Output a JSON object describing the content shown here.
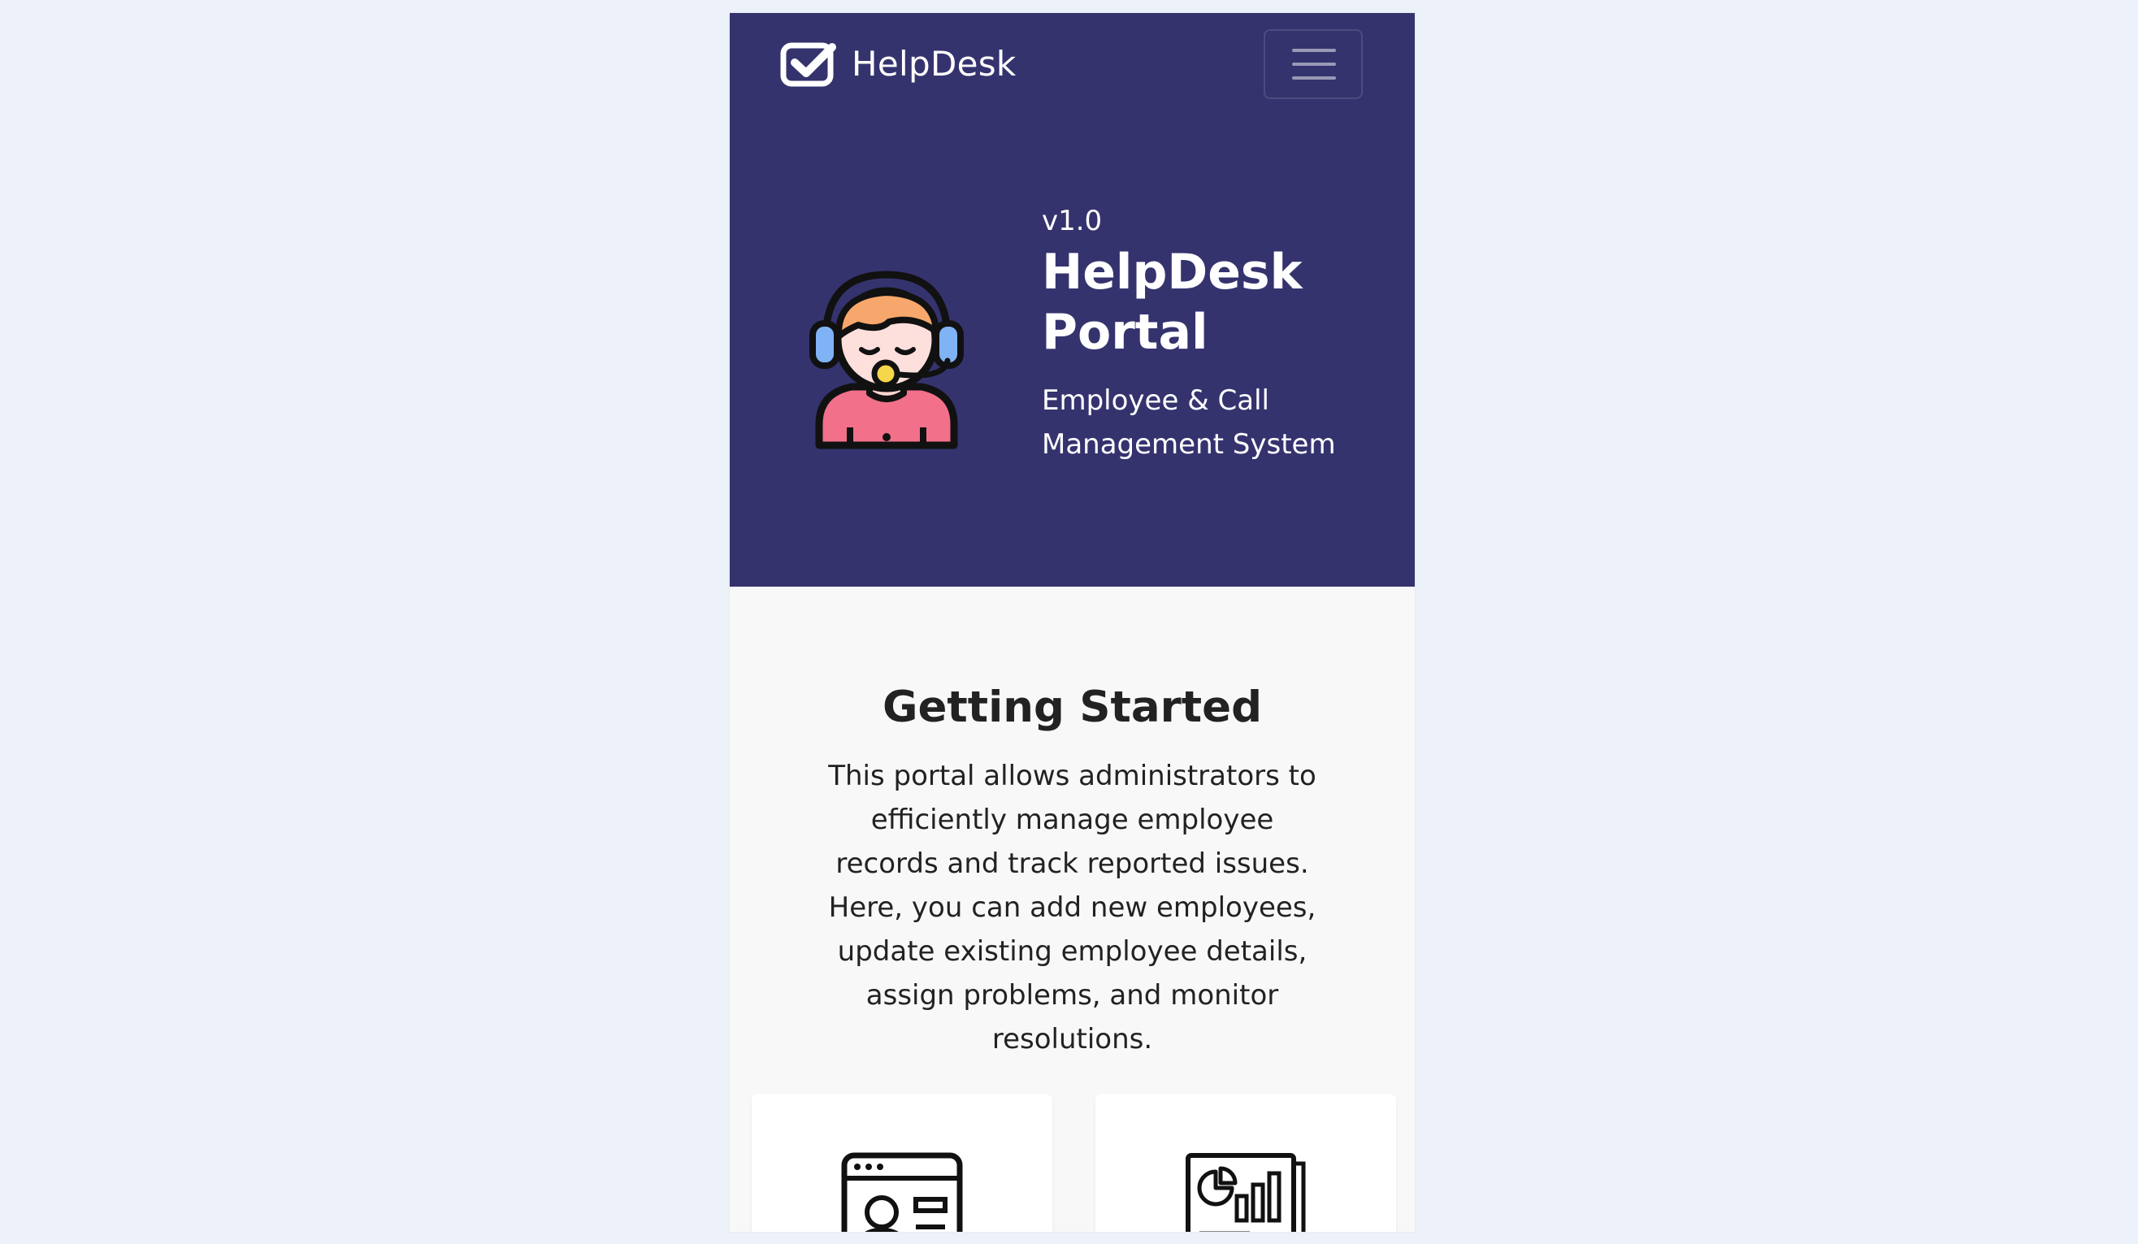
{
  "navbar": {
    "brand_text": "HelpDesk",
    "brand_icon": "checkbox-check-icon",
    "menu_toggle_icon": "hamburger-menu-icon"
  },
  "hero": {
    "version": "v1.0",
    "title": "HelpDesk Portal",
    "subtitle": "Employee & Call Management System",
    "illustration": "support-agent-headset-icon"
  },
  "intro": {
    "title": "Getting Started",
    "body": "This portal allows administrators to efficiently manage employee records and track reported issues. Here, you can add new employees, update existing employee details, assign problems, and monitor resolutions."
  },
  "cards": [
    {
      "icon": "employee-id-card-window-icon"
    },
    {
      "icon": "analytics-report-document-icon"
    }
  ],
  "colors": {
    "page_background": "#edf1f9",
    "header_background": "#35336e",
    "content_background": "#f8f8f8",
    "card_background": "#ffffff",
    "text_light": "#ffffff",
    "text_dark": "#222222"
  }
}
